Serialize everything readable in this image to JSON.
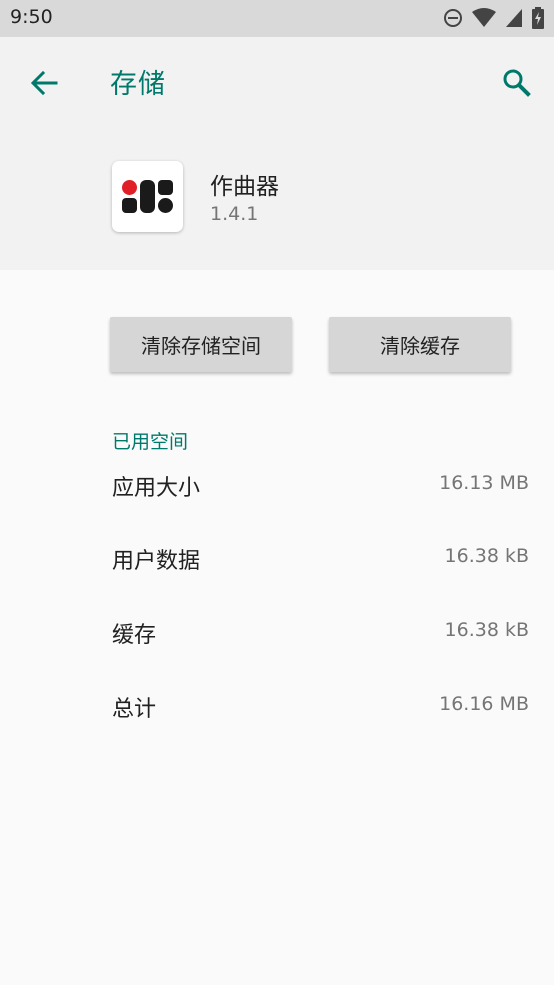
{
  "status_bar": {
    "time": "9:50",
    "icons": [
      "do-not-disturb-icon",
      "wifi-icon",
      "cell-signal-icon",
      "battery-charging-icon"
    ]
  },
  "toolbar": {
    "back_icon": "arrow-left-icon",
    "title": "存储",
    "search_icon": "search-icon"
  },
  "app": {
    "name": "作曲器",
    "version": "1.4.1"
  },
  "actions": {
    "clear_storage": "清除存储空间",
    "clear_cache": "清除缓存"
  },
  "usage": {
    "section_title": "已用空间",
    "rows": [
      {
        "label": "应用大小",
        "value": "16.13 MB"
      },
      {
        "label": "用户数据",
        "value": "16.38 kB"
      },
      {
        "label": "缓存",
        "value": "16.38 kB"
      },
      {
        "label": "总计",
        "value": "16.16 MB"
      }
    ]
  },
  "colors": {
    "accent": "#00796b",
    "header_bg": "#f2f2f2",
    "status_bar_bg": "#d9d9d9",
    "button_bg": "#d6d6d6",
    "icon_red": "#e01f26"
  }
}
